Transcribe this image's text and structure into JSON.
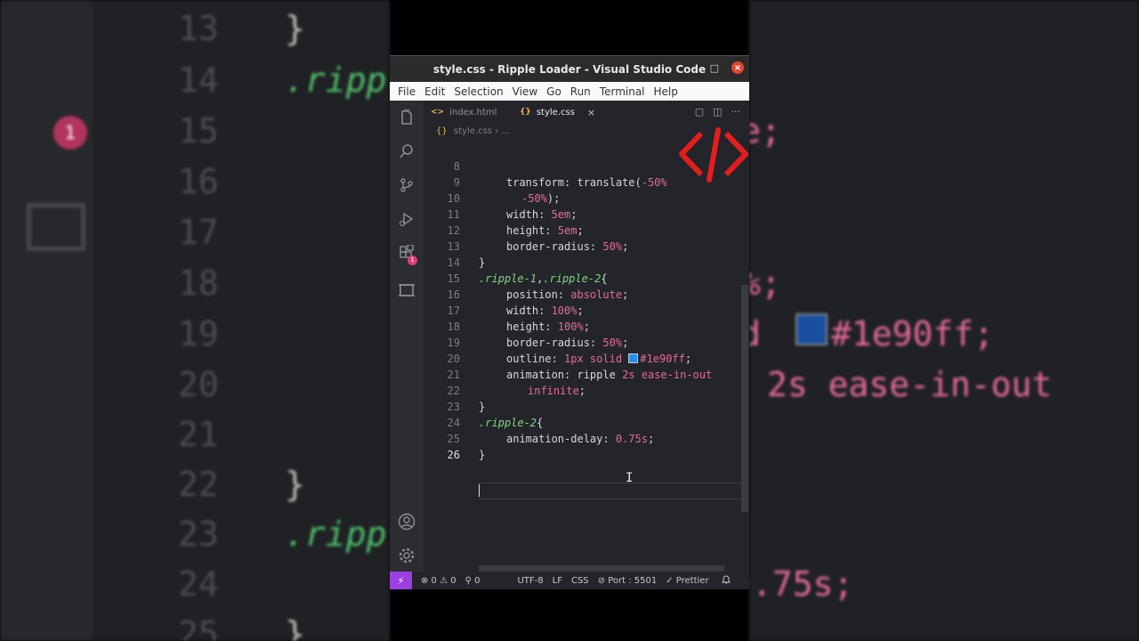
{
  "window": {
    "title": "style.css - Ripple Loader - Visual Studio Code",
    "min": "–",
    "max": "□",
    "close": "×"
  },
  "menu": [
    "File",
    "Edit",
    "Selection",
    "View",
    "Go",
    "Run",
    "Terminal",
    "Help"
  ],
  "tabs": [
    {
      "label": "index.html",
      "icon": "<>"
    },
    {
      "label": "style.css",
      "icon": "{}",
      "close": "×"
    }
  ],
  "breadcrumb": {
    "file": "style.css",
    "sep": "› ..."
  },
  "activity_badge": "1",
  "code_lines": [
    {
      "n": "8"
    },
    {
      "n": "9"
    },
    {
      "n": "10"
    },
    {
      "n": "11"
    },
    {
      "n": "12"
    },
    {
      "n": "13"
    },
    {
      "n": "14"
    },
    {
      "n": "15"
    },
    {
      "n": "16"
    },
    {
      "n": "17"
    },
    {
      "n": "18"
    },
    {
      "n": "19"
    },
    {
      "n": "20"
    },
    {
      "n": "21"
    },
    {
      "n": "22"
    },
    {
      "n": "23"
    },
    {
      "n": "24"
    },
    {
      "n": "25"
    },
    {
      "n": "26"
    }
  ],
  "code": {
    "l8a": "transform",
    "l8b": ": translate(",
    "l8c": "-50%",
    "l9": "-50%",
    "l9b": ");",
    "l10a": "width",
    "l10b": ": ",
    "l10c": "5em",
    "l10d": ";",
    "l11a": "height",
    "l11c": "5em",
    "l12a": "border-radius",
    "l12c": "50%",
    "l13": "}",
    "l14a": ".ripple-1",
    "l14b": ",",
    "l14c": ".ripple-2",
    "l14d": "{",
    "l15a": "position",
    "l15c": "absolute",
    "l16a": "width",
    "l16c": "100%",
    "l17a": "height",
    "l17c": "100%",
    "l18a": "border-radius",
    "l18c": "50%",
    "l19a": "outline",
    "l19c": "1px solid",
    "l19d": "#1e90ff",
    "l20a": "animation",
    "l20b": "ripple",
    "l20c": "2s ease-in-out",
    "l21": "infinite",
    "l22": "}",
    "l23a": ".ripple-2",
    "l23b": "{",
    "l24a": "animation-delay",
    "l24c": "0.75s",
    "l25": "}"
  },
  "status": {
    "errors": "⊗ 0 ⚠ 0",
    "ports": "⚲ 0",
    "encoding": "UTF-8",
    "eol": "LF",
    "lang": "CSS",
    "port": "⊘ Port : 5501",
    "prettier": "✓ Prettier",
    "bell": "🔔"
  },
  "background": {
    "left_nums": [
      "13",
      "14",
      "15",
      "16",
      "17",
      "18",
      "19",
      "20",
      "21",
      "22",
      "23",
      "24",
      "25"
    ],
    "left_badge": "1",
    "right_frag": {
      "l15": "e;",
      "l18": "%;",
      "l19a": "d",
      "l19b": "#1e90ff;",
      "l20": "2s ease-in-out",
      "l24": "0.75s;"
    },
    "left_frag": {
      "brace": "}",
      "rip": ".ripp"
    }
  },
  "colors": {
    "accent": "#1e90ff",
    "selector": "#7ed87e",
    "keyword": "#e66a9c",
    "remote": "#9c3fe0"
  }
}
